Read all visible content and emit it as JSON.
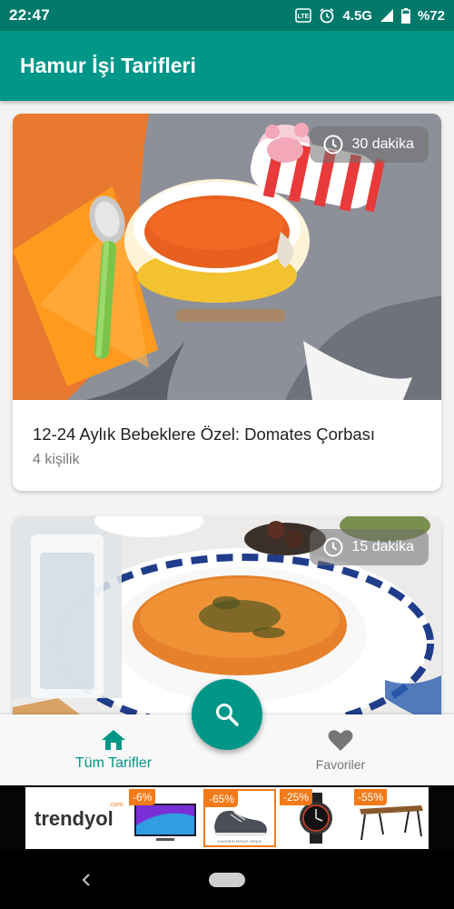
{
  "status_bar": {
    "time": "22:47",
    "network": "4.5G",
    "battery": "%72"
  },
  "app_bar": {
    "title": "Hamur İşi Tarifleri"
  },
  "recipes": [
    {
      "time_label": "30 dakika",
      "title": "12-24 Aylık Bebeklere Özel: Domates Çorbası",
      "servings": "4 kişilik"
    },
    {
      "time_label": "15 dakika"
    }
  ],
  "bottom_nav": {
    "items": [
      {
        "label": "Tüm Tarifler",
        "icon": "home-icon",
        "active": true
      },
      {
        "label": "Favoriler",
        "icon": "heart-icon",
        "active": false
      }
    ],
    "fab_icon": "search-icon"
  },
  "ad": {
    "brand": "trendyol",
    "brand_suffix": ".com",
    "tiles": [
      {
        "badge": "-6%",
        "icon": "tv-icon"
      },
      {
        "badge": "-65%",
        "icon": "shoe-icon",
        "caption": "KAYDIRIN FIRSAT DENIZI"
      },
      {
        "badge": "-25%",
        "icon": "watch-icon"
      },
      {
        "badge": "-55%",
        "icon": "table-icon"
      }
    ]
  },
  "colors": {
    "primary": "#009688",
    "primary_dark": "#00796b",
    "ad_accent": "#f27a1a"
  }
}
